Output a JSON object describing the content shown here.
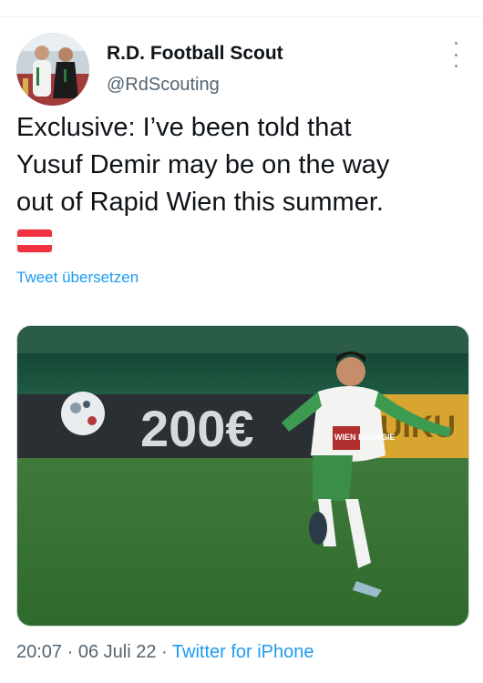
{
  "author": {
    "display_name": "R.D. Football Scout",
    "handle": "@RdScouting",
    "avatar_icon": "profile-photo"
  },
  "tweet": {
    "line1": "Exclusive: I’ve been told that",
    "line2": "Yusuf Demir may be on the way",
    "line3": "out of Rapid Wien this summer.",
    "flag": "austria-flag",
    "translate_label": "Tweet übersetzen"
  },
  "media": {
    "banner_text": "200€",
    "banner_text_right": "UIKU",
    "jersey_text": "WIEN ENERGIE"
  },
  "meta": {
    "time": "20:07",
    "separator1": " · ",
    "date": "06 Juli 22",
    "separator2": " · ",
    "source": "Twitter for iPhone"
  },
  "colors": {
    "accent": "#1d9bf0",
    "secondary_text": "#536471",
    "flag_red": "#ef3340"
  }
}
